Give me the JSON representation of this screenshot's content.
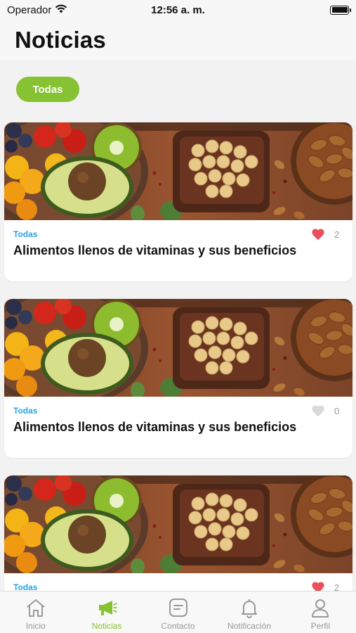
{
  "status_bar": {
    "carrier": "Operador",
    "time": "12:56 a. m."
  },
  "header": {
    "title": "Noticias"
  },
  "filters": {
    "selected": "Todas"
  },
  "articles": [
    {
      "category": "Todas",
      "title": "Alimentos llenos de vitaminas y sus beneficios",
      "likes": "2",
      "liked": true
    },
    {
      "category": "Todas",
      "title": "Alimentos llenos de vitaminas y sus beneficios",
      "likes": "0",
      "liked": false
    },
    {
      "category": "Todas",
      "title": "",
      "likes": "2",
      "liked": true
    }
  ],
  "tab_bar": {
    "tabs": [
      {
        "label": "Inicio",
        "icon": "home-icon"
      },
      {
        "label": "Noticias",
        "icon": "megaphone-icon",
        "active": true
      },
      {
        "label": "Contacto",
        "icon": "message-icon"
      },
      {
        "label": "Notificación",
        "icon": "bell-icon"
      },
      {
        "label": "Perfil",
        "icon": "user-icon"
      }
    ]
  },
  "colors": {
    "accent": "#86c232",
    "category": "#2aa3e0",
    "heart_liked": "#e8505b",
    "heart_unliked": "#d9d9d9"
  }
}
